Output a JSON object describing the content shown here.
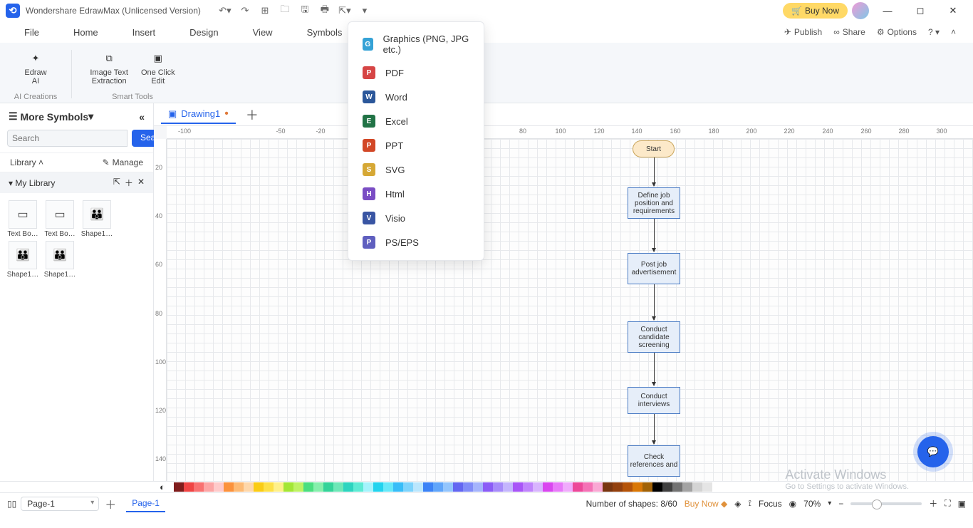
{
  "titlebar": {
    "app_name": "Wondershare EdrawMax (Unlicensed Version)",
    "buy_now": "Buy Now"
  },
  "menubar": {
    "items": [
      "File",
      "Home",
      "Insert",
      "Design",
      "View",
      "Symbols"
    ],
    "right": {
      "publish": "Publish",
      "share": "Share",
      "options": "Options"
    }
  },
  "ribbon": {
    "ai": {
      "btn": "Edraw\nAI",
      "group": "AI Creations"
    },
    "tools": {
      "img": "Image Text\nExtraction",
      "one": "One Click\nEdit",
      "group": "Smart Tools"
    }
  },
  "sidebar": {
    "title": "More Symbols",
    "search_placeholder": "Search",
    "search_btn": "Search",
    "library": "Library",
    "manage": "Manage",
    "mylib": "My Library",
    "shapes": [
      "Text Bo…",
      "Text Bo…",
      "Shape1…",
      "Shape1…",
      "Shape1…"
    ]
  },
  "doc_tab": "Drawing1",
  "export_menu": [
    {
      "label": "Graphics (PNG, JPG etc.)",
      "bg": "#35a2d6",
      "t": "G"
    },
    {
      "label": "PDF",
      "bg": "#d64545",
      "t": "P"
    },
    {
      "label": "Word",
      "bg": "#2b579a",
      "t": "W"
    },
    {
      "label": "Excel",
      "bg": "#217346",
      "t": "E"
    },
    {
      "label": "PPT",
      "bg": "#d24726",
      "t": "P"
    },
    {
      "label": "SVG",
      "bg": "#d6a835",
      "t": "S"
    },
    {
      "label": "Html",
      "bg": "#7a4dc4",
      "t": "H"
    },
    {
      "label": "Visio",
      "bg": "#3955a3",
      "t": "V"
    },
    {
      "label": "PS/EPS",
      "bg": "#5f5fbf",
      "t": "P"
    }
  ],
  "ruler_h": [
    -100,
    -50,
    -20,
    80,
    100,
    120,
    140,
    160,
    180,
    200,
    220,
    240,
    260,
    280,
    300
  ],
  "ruler_h_pos": [
    25,
    160,
    216,
    500,
    553,
    607,
    660,
    714,
    768,
    821,
    874,
    928,
    982,
    1035,
    1088
  ],
  "ruler_v": [
    20,
    40,
    60,
    80,
    100,
    120,
    140
  ],
  "ruler_v_pos": [
    40,
    108,
    176,
    245,
    313,
    381,
    449
  ],
  "flow": {
    "start": "Start",
    "n1": "Define job position and requirements",
    "n2": "Post job advertisement",
    "n3": "Conduct candidate screening",
    "n4": "Conduct interviews",
    "n5": "Check references and"
  },
  "colorbar": [
    "#7f1d1d",
    "#ef4444",
    "#f87171",
    "#fca5a5",
    "#fecaca",
    "#fb923c",
    "#fdba74",
    "#fed7aa",
    "#facc15",
    "#fde047",
    "#fef08a",
    "#a3e635",
    "#bef264",
    "#4ade80",
    "#86efac",
    "#34d399",
    "#6ee7b7",
    "#2dd4bf",
    "#5eead4",
    "#a5f3fc",
    "#22d3ee",
    "#67e8f9",
    "#38bdf8",
    "#7dd3fc",
    "#bae6fd",
    "#3b82f6",
    "#60a5fa",
    "#93c5fd",
    "#6366f1",
    "#818cf8",
    "#a5b4fc",
    "#8b5cf6",
    "#a78bfa",
    "#c4b5fd",
    "#a855f7",
    "#c084fc",
    "#d8b4fe",
    "#d946ef",
    "#e879f9",
    "#f0abfc",
    "#ec4899",
    "#f472b6",
    "#f9a8d4",
    "#78350f",
    "#92400e",
    "#b45309",
    "#d97706",
    "#a16207",
    "#000000",
    "#404040",
    "#737373",
    "#a3a3a3",
    "#d4d4d4",
    "#e5e5e5",
    "#ffffff"
  ],
  "status": {
    "page_sel": "Page-1",
    "page_tab": "Page-1",
    "shapes": "Number of shapes: 8/60",
    "buynow": "Buy Now",
    "focus": "Focus",
    "zoom": "70%"
  },
  "watermark": {
    "title": "Activate Windows",
    "sub": "Go to Settings to activate Windows."
  }
}
